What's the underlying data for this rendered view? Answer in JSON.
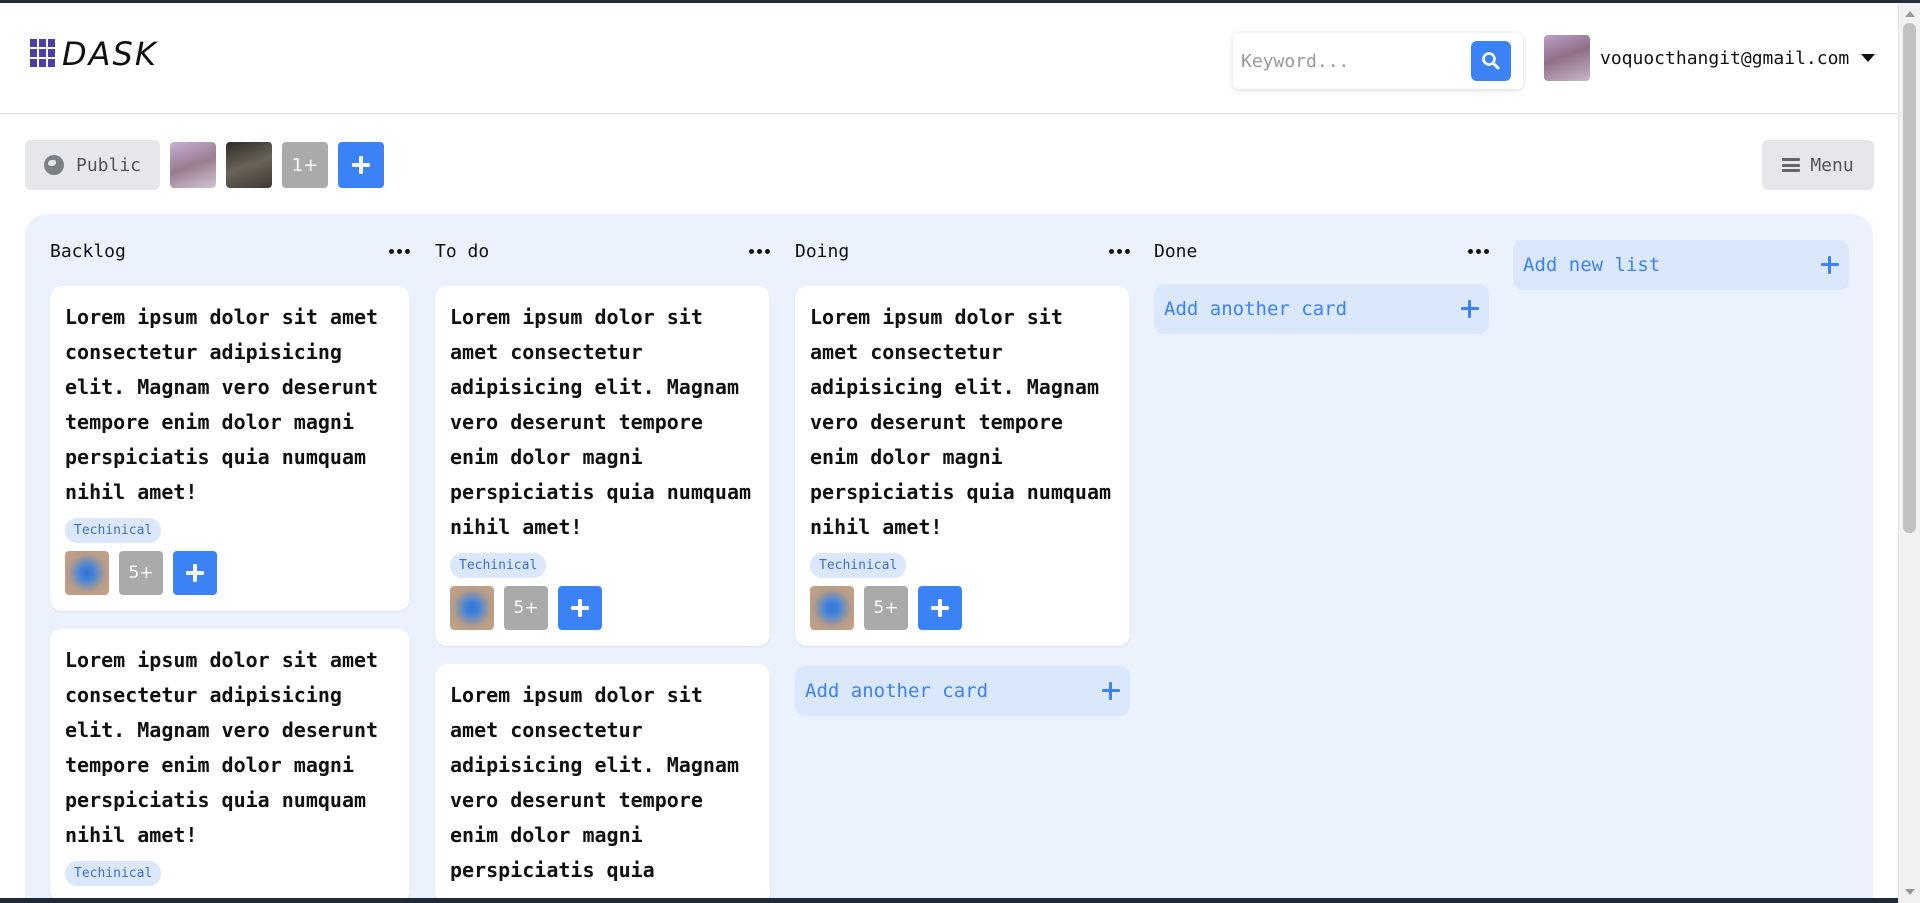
{
  "app": {
    "logo_text": "DASK"
  },
  "header": {
    "search": {
      "placeholder": "Keyword...",
      "icon": "search-icon"
    },
    "user": {
      "email": "voquocthangit@gmail.com",
      "avatar": "avatar",
      "dropdown_icon": "chevron-down-icon"
    }
  },
  "toolbar": {
    "visibility_label": "Public",
    "visibility_icon": "globe-icon",
    "members_more": "1+",
    "menu_label": "Menu"
  },
  "board": {
    "columns": [
      {
        "title": "Backlog",
        "cards": [
          {
            "text": "Lorem ipsum dolor sit amet consectetur adipisicing elit. Magnam vero deserunt tempore enim dolor magni perspiciatis quia numquam nihil amet!",
            "tag": "Techinical",
            "members_more": "5+"
          },
          {
            "text": "Lorem ipsum dolor sit amet consectetur adipisicing elit. Magnam vero deserunt tempore enim dolor magni perspiciatis quia numquam nihil amet!",
            "tag": "Techinical"
          }
        ]
      },
      {
        "title": "To do",
        "cards": [
          {
            "text": "Lorem ipsum dolor sit amet consectetur adipisicing elit. Magnam vero deserunt tempore enim dolor magni perspiciatis quia numquam nihil amet!",
            "tag": "Techinical",
            "members_more": "5+"
          },
          {
            "text": "Lorem ipsum dolor sit amet consectetur adipisicing elit. Magnam vero deserunt tempore enim dolor magni perspiciatis quia"
          }
        ]
      },
      {
        "title": "Doing",
        "cards": [
          {
            "text": "Lorem ipsum dolor sit amet consectetur adipisicing elit. Magnam vero deserunt tempore enim dolor magni perspiciatis quia numquam nihil amet!",
            "tag": "Techinical",
            "members_more": "5+"
          }
        ],
        "add_card_label": "Add another card"
      },
      {
        "title": "Done",
        "cards": [],
        "add_card_label": "Add another card"
      }
    ],
    "add_list_label": "Add new list"
  },
  "colors": {
    "accent": "#3b82f6",
    "board_bg": "#ecf2fd",
    "tag_bg": "#dbe7fb"
  }
}
